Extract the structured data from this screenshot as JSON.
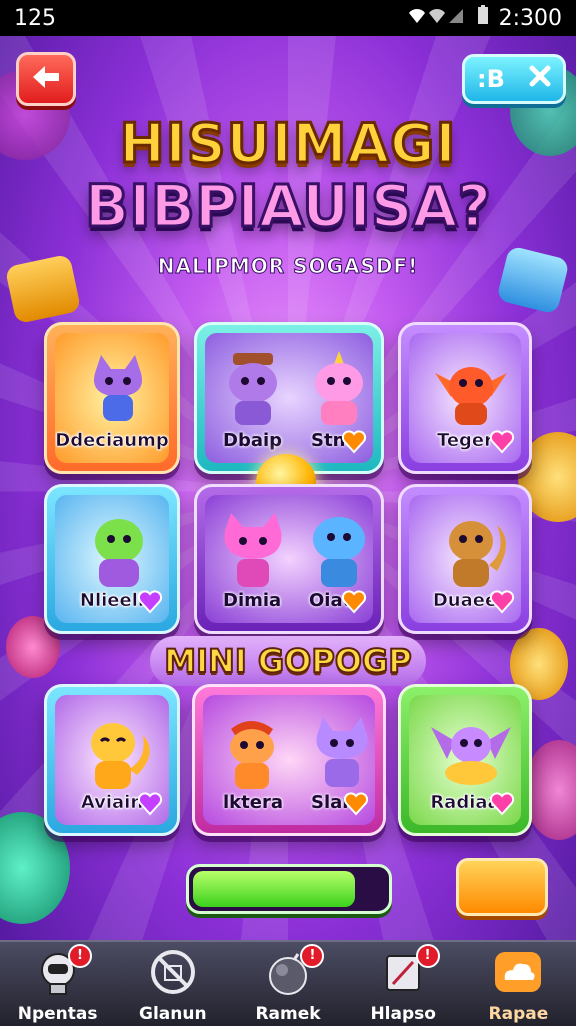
{
  "status_bar": {
    "left": "125",
    "time": "2:300"
  },
  "header": {
    "close_text": ":B"
  },
  "title": {
    "line1": "HISUIMAGI",
    "line2": "BIBPIAUISA?"
  },
  "subtitle": "NALIPMOR SOGASDF!",
  "top_grid": [
    {
      "label": "Ddeciaump"
    },
    {
      "label_left": "Dbaip",
      "label_right": "Stno"
    },
    {
      "label": "Teger"
    },
    {
      "label": "Nlieell"
    },
    {
      "label_left": "Dimia",
      "label_right": "Oiat"
    },
    {
      "label": "Duaee"
    }
  ],
  "section_title": "MINI GOPOGP",
  "bottom_grid": [
    {
      "label": "Aviain"
    },
    {
      "label_left": "lktera",
      "label_right": "Slan"
    },
    {
      "label": "Radiaa"
    }
  ],
  "progress": {
    "value": 0.85
  },
  "bottom_nav": [
    {
      "label": "Npentas",
      "icon": "robot-icon",
      "badge": "!"
    },
    {
      "label": "Glanun",
      "icon": "no-entry-icon"
    },
    {
      "label": "Ramek",
      "icon": "bomb-icon",
      "badge": "!"
    },
    {
      "label": "Hlapso",
      "icon": "card-icon",
      "badge": "!"
    },
    {
      "label": "Rapae",
      "icon": "cloud-icon"
    }
  ],
  "colors": {
    "accent": "#ffd23b",
    "background": "#b24fe6",
    "nav_active": "#ff9f2a"
  }
}
